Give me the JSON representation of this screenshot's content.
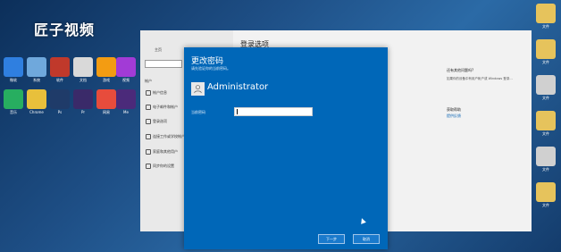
{
  "watermark": "匠子视频",
  "desktop_icons_left": [
    {
      "label": "微软",
      "color": "#2f7fe0"
    },
    {
      "label": "系统",
      "color": "#6fa8dc"
    },
    {
      "label": "软件",
      "color": "#c0392b"
    },
    {
      "label": "文档",
      "color": "#d9d9d9"
    },
    {
      "label": "游戏",
      "color": "#f39c12"
    },
    {
      "label": "视频",
      "color": "#a23bd6"
    },
    {
      "label": "音乐",
      "color": "#27ae60"
    },
    {
      "label": "Chrome",
      "color": "#e8c03b"
    },
    {
      "label": "Ps",
      "color": "#1f3b69"
    },
    {
      "label": "Pr",
      "color": "#3a2a69"
    },
    {
      "label": "网易",
      "color": "#e74c3c"
    },
    {
      "label": "Me",
      "color": "#4b2a7a"
    }
  ],
  "desktop_icons_right": [
    {
      "label": "文件",
      "color": "#e6c35c"
    },
    {
      "label": "文件",
      "color": "#e6c35c"
    },
    {
      "label": "文件",
      "color": "#d0d0d0"
    },
    {
      "label": "文件",
      "color": "#e6c35c"
    },
    {
      "label": "文件",
      "color": "#d0d0d0"
    },
    {
      "label": "文件",
      "color": "#e6c35c"
    }
  ],
  "settings": {
    "home": "主页",
    "section": "帐户",
    "items": [
      "帐户信息",
      "电子邮件和帐户",
      "登录选项",
      "连接工作或学校帐户",
      "家庭和其他用户",
      "同步你的设置"
    ],
    "title": "登录选项",
    "right_heading": "还有其他问题吗?",
    "right_desc": "如果你的设备中有用户帐户或 Windows 登录...",
    "right_link_heading": "获取帮助",
    "right_link": "提供反馈"
  },
  "dialog": {
    "title": "更改密码",
    "subtitle": "请先验证你的当前密码。",
    "username": "Administrator",
    "password_label": "当前密码",
    "password_value": "",
    "next_button": "下一步",
    "cancel_button": "取消",
    "accent_color": "#0067b8"
  }
}
